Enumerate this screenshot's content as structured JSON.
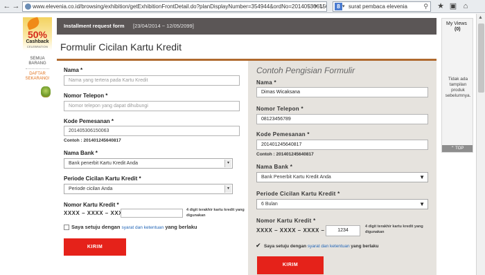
{
  "browser": {
    "url": "www.elevenia.co.id/browsing/exhibition/getExhibitionFrontDetail.do?planDisplayNumber=354944&ordNo=201405306150063",
    "search_text": "surat pembaca elevenia",
    "search_engine_letter": "8"
  },
  "sidebar": {
    "promo_percent": "50%",
    "promo_label": "Cashback",
    "promo_sub": "CELEBRATION",
    "item1_line1": "SEMUA",
    "item1_line2": "BARANG",
    "item2_line1": "DAFTAR",
    "item2_line2": "SEKARANG!"
  },
  "header": {
    "title": "Installment request form",
    "dates": "[23/04/2014 ~ 12/05/2099]"
  },
  "page_title": "Formulir Cicilan Kartu Kredit",
  "form": {
    "name_label": "Nama *",
    "name_placeholder": "Nama yang tertera pada Kartu Kredit",
    "phone_label": "Nomor Telepon *",
    "phone_placeholder": "Nomor telepon yang dapat dihubungi",
    "order_label": "Kode Pemesanan *",
    "order_value": "201405306150063",
    "order_example": "Contoh : 201401245640817",
    "bank_label": "Nama Bank *",
    "bank_selected": "Bank penerbit Kartu Kredit Anda",
    "period_label": "Periode Cicilan Kartu Kredit *",
    "period_selected": "Periode cicilan Anda",
    "card_label": "Nomor Kartu Kredit *",
    "card_mask": "XXXX – XXXX – XXXX –",
    "card_value": "",
    "card_hint": "4 digit terakhir kartu kredit yang digunakan",
    "agree_prefix": "Saya setuju dengan",
    "agree_link": "syarat dan ketentuan",
    "agree_suffix": "yang berlaku",
    "submit_label": "KIRIM"
  },
  "example": {
    "title": "Contoh Pengisian Formulir",
    "name_label": "Nama *",
    "name_value": "Dimas Wicaksana",
    "phone_label": "Nomor Telepon *",
    "phone_value": "08123456789",
    "order_label": "Kode Pemesanan *",
    "order_value": "201401245640817",
    "order_example": "Contoh : 201401245640817",
    "bank_label": "Nama Bank *",
    "bank_selected": "Bank Penerbit Kartu Kredit Anda",
    "period_label": "Periode Cicilan Kartu Kredit *",
    "period_selected": "6 Bulan",
    "card_label": "Nomor Kartu Kredit *",
    "card_mask": "XXXX – XXXX – XXXX –",
    "card_value": "1234",
    "card_hint": "4 digit terakhir kartu kredit yang digunakan",
    "agree_prefix": "Saya setuju dengan",
    "agree_link": "syarat dan ketentuan",
    "agree_suffix": "yang berlaku",
    "submit_label": "KIRIM"
  },
  "myviews": {
    "title": "My Views",
    "count": "(0)",
    "empty_text": "Tidak ada tampilan produk sebelumnya.",
    "top_label": "⌃ TOP"
  },
  "colors": {
    "accent": "#e5221a",
    "header_bg": "#5b5656",
    "title_rule": "#b06a2f",
    "example_bg": "#e6e3de",
    "link": "#1f63b5"
  }
}
